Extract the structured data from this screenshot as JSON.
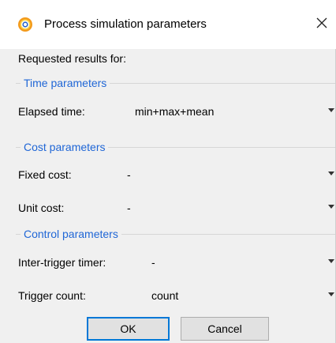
{
  "window": {
    "title": "Process simulation parameters",
    "app_icon": "gear-ring-icon",
    "close_icon": "close-icon",
    "accent_color": "#1f66d6",
    "default_button_border": "#0078d7"
  },
  "requested_label": "Requested results for:",
  "groups": {
    "time": {
      "title": "Time parameters",
      "elapsed": {
        "label": "Elapsed time:",
        "value": "min+max+mean"
      }
    },
    "cost": {
      "title": "Cost parameters",
      "fixed": {
        "label": "Fixed cost:",
        "value": "-"
      },
      "unit": {
        "label": "Unit cost:",
        "value": "-"
      }
    },
    "control": {
      "title": "Control parameters",
      "inter_trigger": {
        "label": "Inter-trigger timer:",
        "value": "-"
      },
      "trigger_count": {
        "label": "Trigger count:",
        "value": "count"
      }
    }
  },
  "buttons": {
    "ok": "OK",
    "cancel": "Cancel"
  }
}
